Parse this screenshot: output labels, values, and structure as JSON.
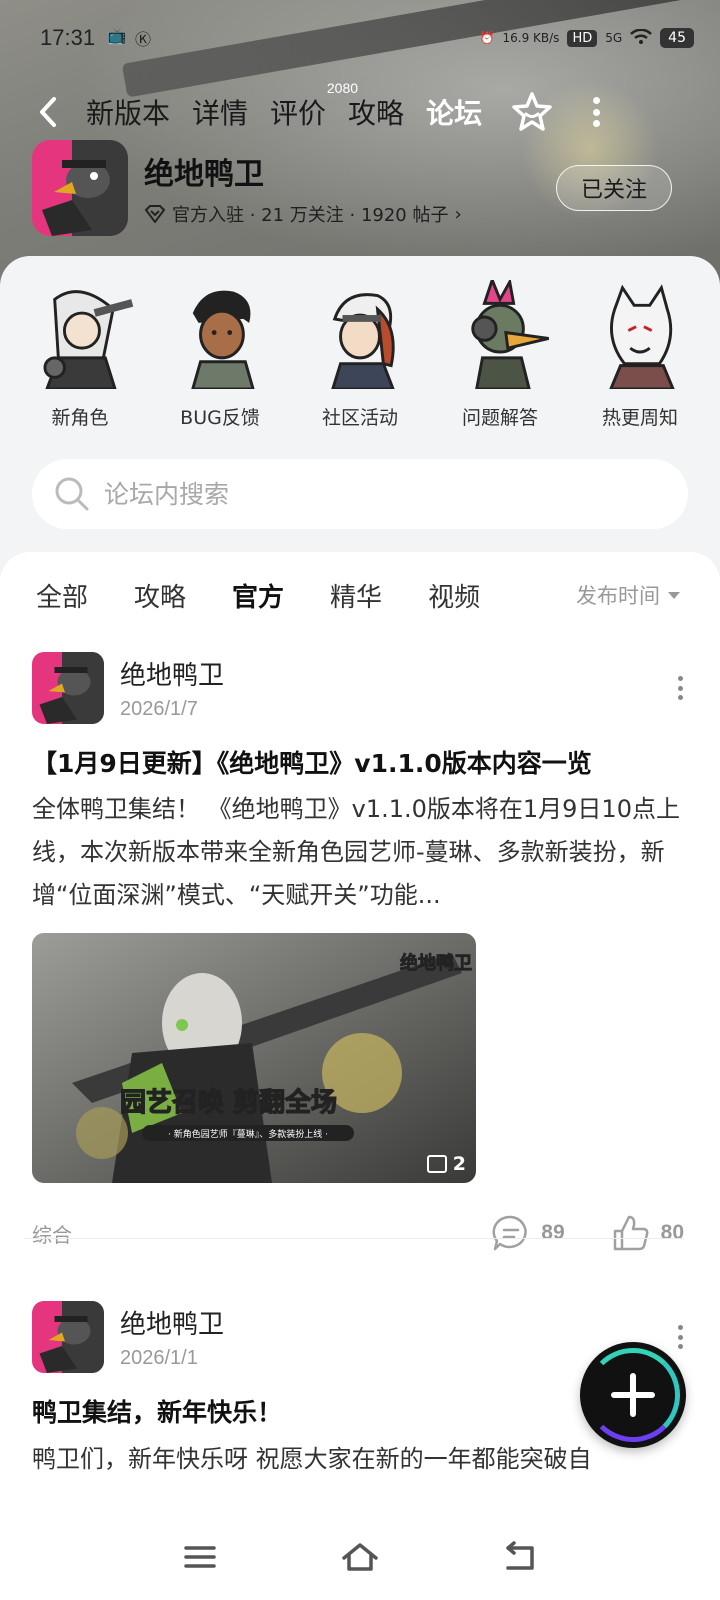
{
  "status": {
    "time": "17:31",
    "net_speed": "16.9 KB/s",
    "hd": "HD",
    "signal": "5G",
    "battery": "45"
  },
  "nav": {
    "tabs": [
      "新版本",
      "详情",
      "评价",
      "攻略",
      "论坛"
    ],
    "active_tab": "论坛",
    "review_count": "2080"
  },
  "game": {
    "title": "绝地鸭卫",
    "subtitle": "官方入驻 · 21 万关注 · 1920 帖子",
    "follow_label": "已关注"
  },
  "quick_links": [
    {
      "label": "新角色"
    },
    {
      "label": "BUG反馈"
    },
    {
      "label": "社区活动"
    },
    {
      "label": "问题解答"
    },
    {
      "label": "热更周知"
    }
  ],
  "search": {
    "placeholder": "论坛内搜索"
  },
  "filters": {
    "tabs": [
      "全部",
      "攻略",
      "官方",
      "精华",
      "视频"
    ],
    "active": "官方",
    "sort_label": "发布时间"
  },
  "posts": [
    {
      "author": "绝地鸭卫",
      "date": "2026/1/7",
      "title": "【1月9日更新】《绝地鸭卫》v1.1.0版本内容一览",
      "body": "全体鸭卫集结！ 《绝地鸭卫》v1.1.0版本将在1月9日10点上线，本次新版本带来全新角色园艺师-蔓琳、多款新装扮，新增“位面深渊”模式、“天赋开关”功能...",
      "image_title": "园艺召唤 剪翻全场",
      "image_caption": "· 新角色园艺师『蔓琳』、多款装扮上线 ·",
      "image_logo": "绝地鸭卫",
      "image_count": "2",
      "tag": "综合",
      "comments": "89",
      "likes": "80"
    },
    {
      "author": "绝地鸭卫",
      "date": "2026/1/1",
      "title": "鸭卫集结，新年快乐！",
      "body": "鸭卫们，新年快乐呀 祝愿大家在新的一年都能突破自"
    }
  ],
  "colors": {
    "accent": "#1bc8b6",
    "fab_ring": "#6c3ff0",
    "muted_text": "#999999"
  },
  "icons": [
    "back-icon",
    "star-icon",
    "more-icon",
    "verified-icon",
    "search-icon",
    "comment-icon",
    "like-icon",
    "plus-icon",
    "menu-icon",
    "home-icon",
    "back-nav-icon"
  ]
}
